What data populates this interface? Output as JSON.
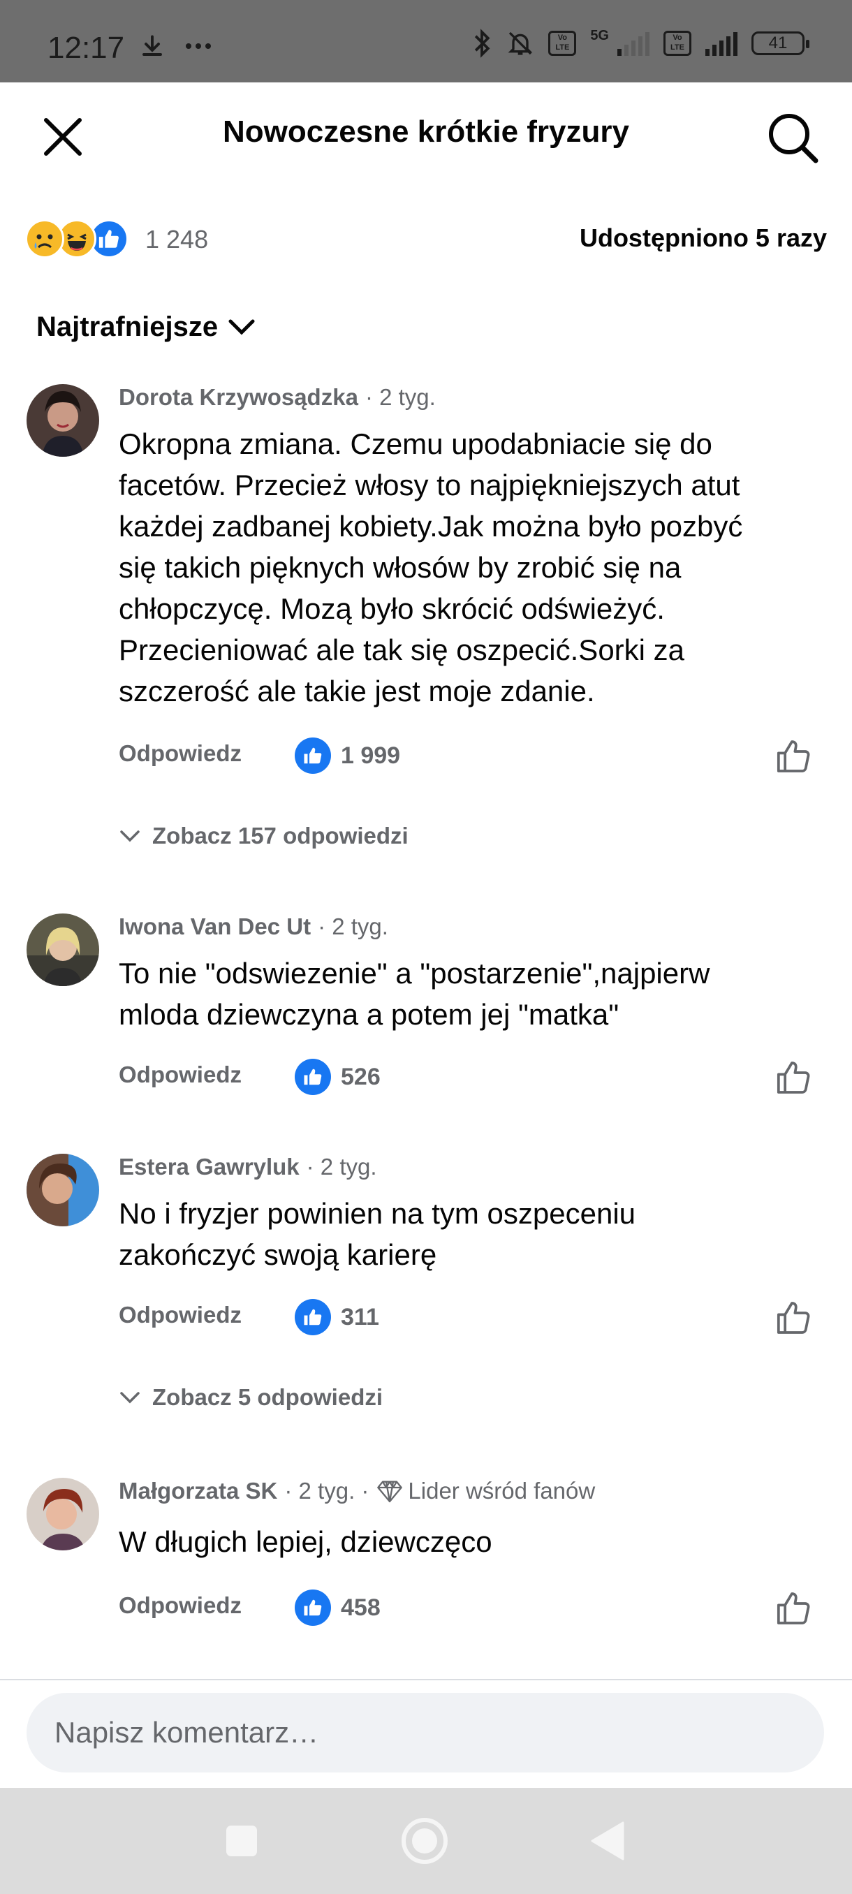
{
  "status_bar": {
    "time": "12:17",
    "network": "5G",
    "volte_label": "Vo LTE",
    "battery": "41"
  },
  "header": {
    "title": "Nowoczesne krótkie fryzury"
  },
  "reactions": {
    "types": [
      "sad",
      "haha",
      "like"
    ],
    "count": "1 248",
    "shares": "Udostępniono 5 razy"
  },
  "sort": {
    "label": "Najtrafniejsze"
  },
  "comments": [
    {
      "author": "Dorota Krzywosądzka",
      "time": "· 2 tyg.",
      "text_lines": [
        "Okropna zmiana. Czemu upodabniacie się do",
        "facetów. Przecież włosy to najpiękniejszych atut",
        "każdej zadbanej kobiety.Jak można było pozbyć",
        "się takich pięknych włosów by zrobić się na",
        "chłopczycę. Mozą było skrócić odświeżyć.",
        "Przecieniować ale tak się oszpecić.Sorki za",
        "szczerość ale takie jest moje zdanie."
      ],
      "reply_label": "Odpowiedz",
      "likes": "1 999",
      "view_replies": "Zobacz 157 odpowiedzi"
    },
    {
      "author": "Iwona Van Dec Ut",
      "time": "· 2 tyg.",
      "text_lines": [
        "To nie \"odswiezenie\" a \"postarzenie\",najpierw",
        "mloda dziewczyna a potem jej \"matka\""
      ],
      "reply_label": "Odpowiedz",
      "likes": "526"
    },
    {
      "author": "Estera Gawryluk",
      "time": "· 2 tyg.",
      "text_lines": [
        "No i fryzjer powinien na tym oszpeceniu",
        "zakończyć swoją karierę"
      ],
      "reply_label": "Odpowiedz",
      "likes": "311",
      "view_replies": "Zobacz 5 odpowiedzi"
    },
    {
      "author": "Małgorzata SK",
      "time": "· 2 tyg. ·",
      "badge": "Lider wśród fanów",
      "text_lines": [
        "W długich lepiej, dziewczęco"
      ],
      "reply_label": "Odpowiedz",
      "likes": "458"
    }
  ],
  "composer": {
    "placeholder": "Napisz komentarz…"
  },
  "colors": {
    "like_blue": "#1877f2",
    "secondary_text": "#65676b",
    "input_bg": "#f0f2f5"
  }
}
